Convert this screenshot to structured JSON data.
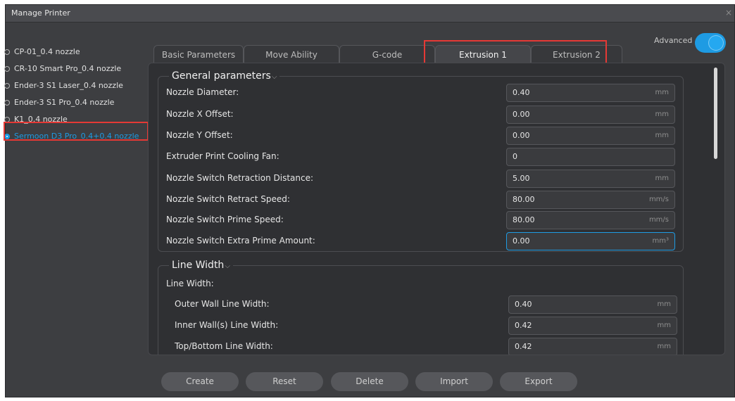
{
  "window": {
    "title": "Manage Printer",
    "close_glyph": "×"
  },
  "printers": [
    {
      "label": "CP-01_0.4 nozzle",
      "selected": false
    },
    {
      "label": "CR-10 Smart Pro_0.4 nozzle",
      "selected": false
    },
    {
      "label": "Ender-3 S1 Laser_0.4 nozzle",
      "selected": false
    },
    {
      "label": "Ender-3 S1 Pro_0.4 nozzle",
      "selected": false
    },
    {
      "label": "K1_0.4 nozzle",
      "selected": false
    },
    {
      "label": "Sermoon D3 Pro_0.4+0.4 nozzle",
      "selected": true
    }
  ],
  "advanced": {
    "label": "Advanced",
    "on": true
  },
  "tabs": [
    {
      "label": "Basic Parameters",
      "active": false
    },
    {
      "label": "Move Ability",
      "active": false
    },
    {
      "label": "G-code",
      "active": false
    },
    {
      "label": "Extrusion 1",
      "active": true
    },
    {
      "label": "Extrusion 2",
      "active": false
    }
  ],
  "general": {
    "title": "General parameters",
    "params": [
      {
        "label": "Nozzle Diameter:",
        "value": "0.40",
        "unit": "mm"
      },
      {
        "label": "Nozzle X Offset:",
        "value": "0.00",
        "unit": "mm"
      },
      {
        "label": "Nozzle Y Offset:",
        "value": "0.00",
        "unit": "mm"
      },
      {
        "label": "Extruder Print Cooling Fan:",
        "value": "0",
        "unit": ""
      },
      {
        "label": "Nozzle Switch Retraction Distance:",
        "value": "5.00",
        "unit": "mm"
      },
      {
        "label": "Nozzle Switch Retract Speed:",
        "value": "80.00",
        "unit": "mm/s"
      },
      {
        "label": "Nozzle Switch Prime Speed:",
        "value": "80.00",
        "unit": "mm/s"
      },
      {
        "label": "Nozzle Switch Extra Prime Amount:",
        "value": "0.00",
        "unit": "mm³"
      }
    ]
  },
  "line_width": {
    "title": "Line Width",
    "sub_label": "Line Width:",
    "params": [
      {
        "label": "Outer Wall Line Width:",
        "value": "0.40",
        "unit": "mm"
      },
      {
        "label": "Inner Wall(s) Line Width:",
        "value": "0.42",
        "unit": "mm"
      },
      {
        "label": "Top/Bottom Line Width:",
        "value": "0.42",
        "unit": "mm"
      }
    ]
  },
  "buttons": {
    "create": "Create",
    "reset": "Reset",
    "delete": "Delete",
    "import": "Import",
    "export": "Export"
  },
  "colors": {
    "accent": "#1e9be3",
    "highlight": "#e53935",
    "panel": "#2f3033",
    "window": "#3d3e41"
  }
}
